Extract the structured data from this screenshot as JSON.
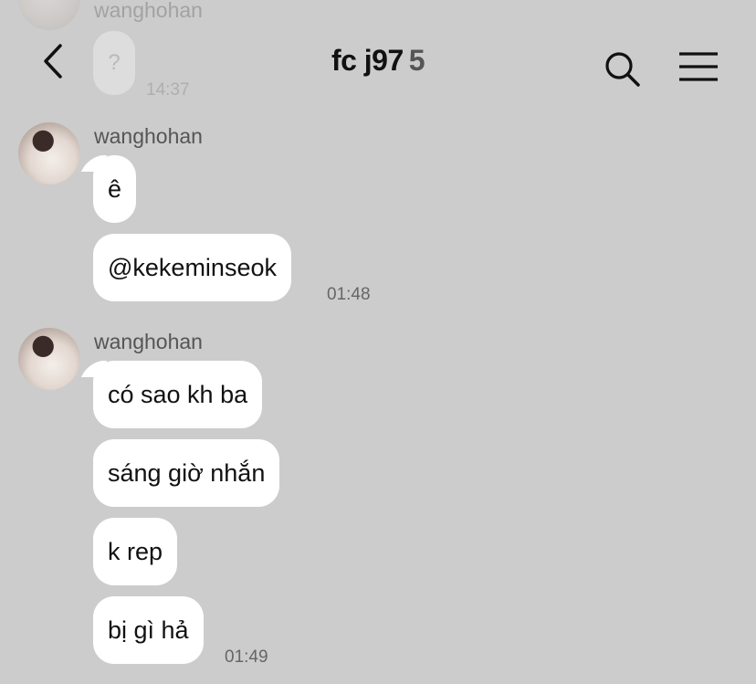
{
  "header": {
    "title": "fc j97",
    "member_count": "5"
  },
  "ghost": {
    "sender": "wanghohan",
    "message": "?",
    "time": "14:37"
  },
  "messages": [
    {
      "sender": "wanghohan",
      "bubbles": [
        "ê",
        "@kekeminseok"
      ],
      "time": "01:48"
    },
    {
      "sender": "wanghohan",
      "bubbles": [
        "có sao kh ba",
        "sáng giờ nhắn",
        "k rep",
        "bị gì hả"
      ],
      "time": "01:49"
    }
  ],
  "icons": {
    "back": "chevron-left-icon",
    "search": "search-icon",
    "menu": "hamburger-menu-icon"
  },
  "colors": {
    "background": "#cccccc",
    "bubble": "#ffffff",
    "text": "#111111",
    "secondary_text": "#555555"
  }
}
